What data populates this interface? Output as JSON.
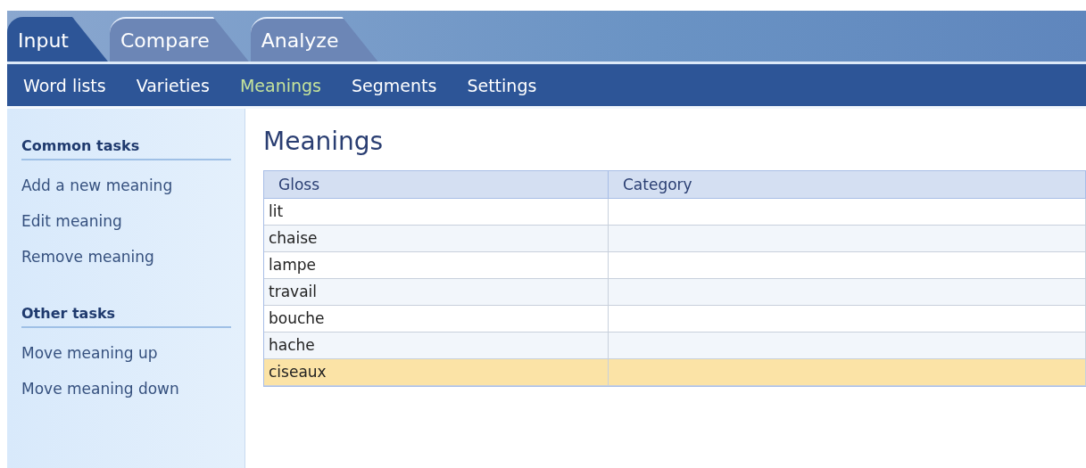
{
  "tabs": [
    {
      "label": "Input",
      "selected": true
    },
    {
      "label": "Compare",
      "selected": false
    },
    {
      "label": "Analyze",
      "selected": false
    }
  ],
  "subnav": [
    {
      "label": "Word lists",
      "selected": false
    },
    {
      "label": "Varieties",
      "selected": false
    },
    {
      "label": "Meanings",
      "selected": true
    },
    {
      "label": "Segments",
      "selected": false
    },
    {
      "label": "Settings",
      "selected": false
    }
  ],
  "sidebar": {
    "groups": [
      {
        "title": "Common tasks",
        "items": [
          "Add a new meaning",
          "Edit meaning",
          "Remove meaning"
        ]
      },
      {
        "title": "Other tasks",
        "items": [
          "Move meaning up",
          "Move meaning down"
        ]
      }
    ]
  },
  "page_title": "Meanings",
  "table": {
    "columns": [
      "Gloss",
      "Category"
    ],
    "rows": [
      {
        "gloss": "lit",
        "selected": false
      },
      {
        "gloss": "chaise",
        "selected": false
      },
      {
        "gloss": "lampe",
        "selected": false
      },
      {
        "gloss": "travail",
        "selected": false
      },
      {
        "gloss": "bouche",
        "selected": false
      },
      {
        "gloss": "hache",
        "selected": false
      },
      {
        "gloss": "ciseaux",
        "selected": true
      }
    ]
  }
}
